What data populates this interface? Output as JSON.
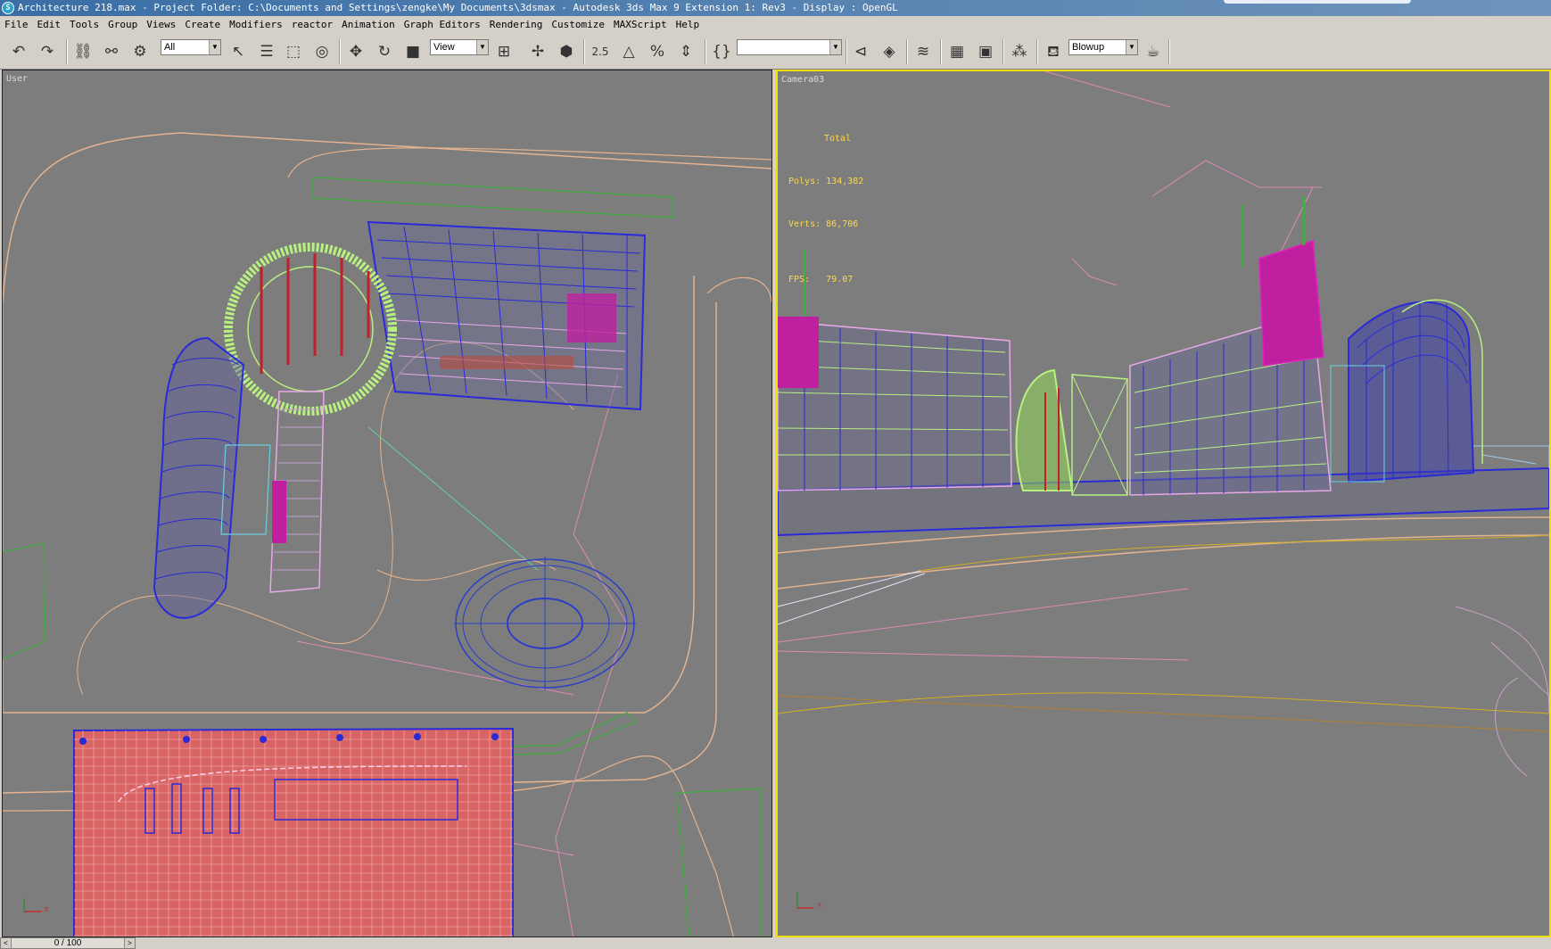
{
  "window": {
    "title": "Architecture 218.max      - Project Folder: C:\\Documents and Settings\\zengke\\My Documents\\3dsmax      - Autodesk 3ds Max 9 Extension 1: Rev3       - Display : OpenGL",
    "app_icon": "3ds-max-logo-icon"
  },
  "menu": [
    "File",
    "Edit",
    "Tools",
    "Group",
    "Views",
    "Create",
    "Modifiers",
    "reactor",
    "Animation",
    "Graph Editors",
    "Rendering",
    "Customize",
    "MAXScript",
    "Help"
  ],
  "toolbar": {
    "selection_filter": "All",
    "reference_coord": "View",
    "named_selection": "",
    "render_type": "Blowup",
    "snap_value": "2.5"
  },
  "viewports": {
    "left": {
      "label": "User"
    },
    "right": {
      "label": "Camera03",
      "stats_header": "Total",
      "polys_label": "Polys:",
      "polys_value": "134,382",
      "verts_label": "Verts:",
      "verts_value": "86,706",
      "fps_label": "FPS:",
      "fps_value": "79.07"
    }
  },
  "status": {
    "time_slider": "0 / 100"
  },
  "colors": {
    "viewport_bg": "#7d7d7d",
    "active_viewport_border": "#f0e000",
    "stats_text": "#ffd84a"
  }
}
